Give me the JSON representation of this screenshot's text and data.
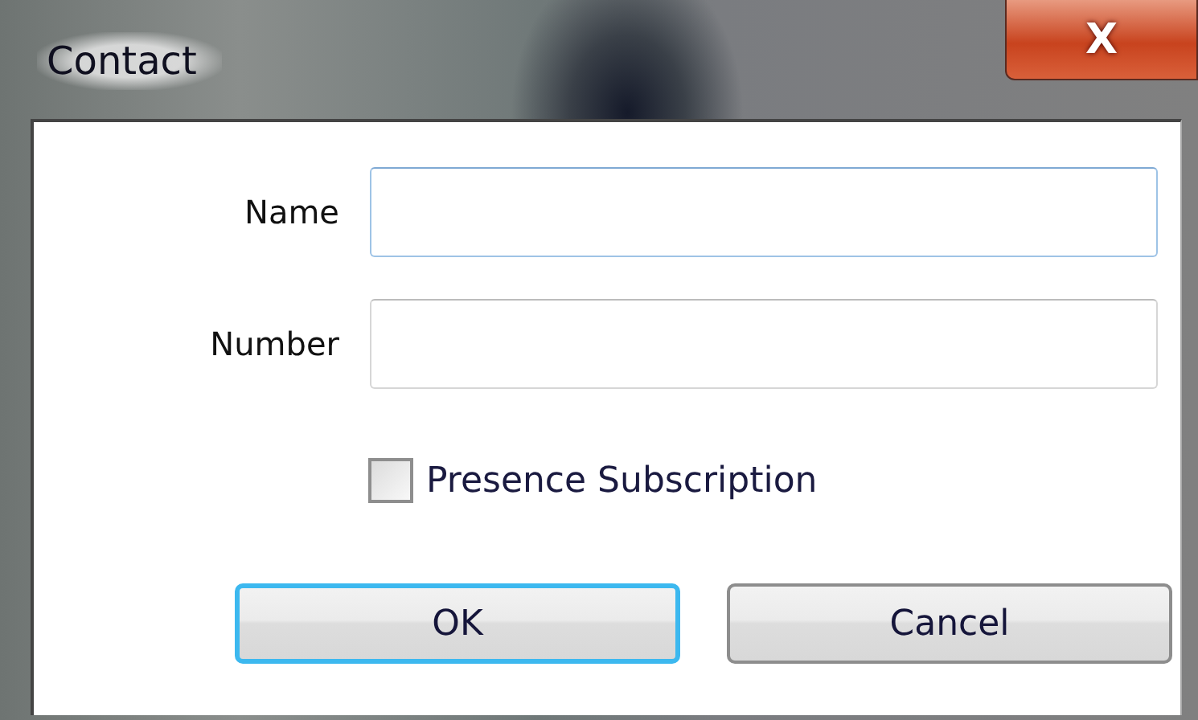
{
  "window": {
    "title": "Contact",
    "close_label": "X"
  },
  "fields": [
    {
      "label": "Name",
      "focused": true
    },
    {
      "label": "Number",
      "focused": false
    }
  ],
  "checkbox": {
    "label": "Presence Subscription",
    "checked": false
  },
  "buttons": [
    {
      "label": "OK",
      "default": true
    },
    {
      "label": "Cancel",
      "default": false
    }
  ]
}
